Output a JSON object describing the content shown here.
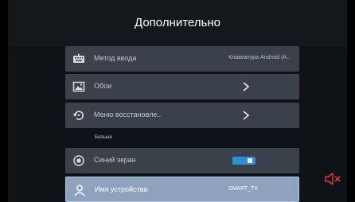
{
  "header": {
    "title": "Дополнительно"
  },
  "settings": {
    "items": [
      {
        "label": "Метод ввода",
        "value": "Клавиатура Android (А..",
        "icon": "keyboard-icon"
      },
      {
        "label": "Обои",
        "icon": "wallpaper-icon"
      },
      {
        "label": "Меню восстановле..",
        "icon": "restore-icon"
      }
    ],
    "section_label": "Больше",
    "more_items": [
      {
        "label": "Синий экран",
        "icon": "screen-icon",
        "toggle_on": true
      },
      {
        "label": "Имя устройства",
        "value": "SMART_TV",
        "icon": "person-icon"
      }
    ]
  },
  "status": {
    "mute_icon": "speaker-muted-icon"
  },
  "colors": {
    "accent": "#2f8fd6",
    "selected": "#8ea1bd",
    "mute": "#e0393d"
  }
}
